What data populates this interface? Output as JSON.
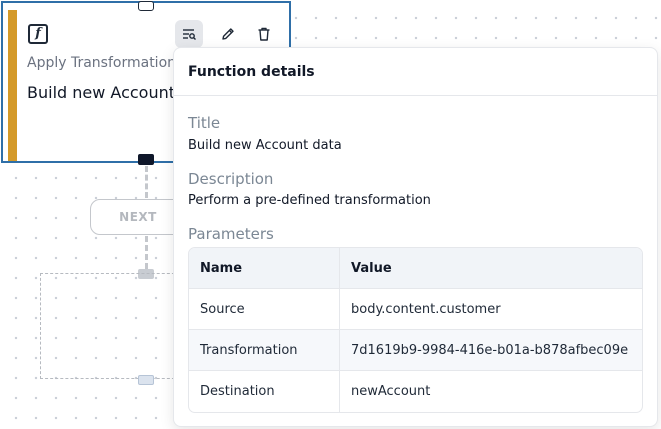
{
  "node": {
    "type_label": "Apply Transformation",
    "title": "Build new Account data",
    "icon": "function-icon",
    "accent_color": "#d49a2a"
  },
  "toolbar": {
    "details_icon": "details-list-icon",
    "edit_icon": "pencil-icon",
    "delete_icon": "trash-icon"
  },
  "canvas": {
    "next_label": "NEXT"
  },
  "popover": {
    "header": "Function details",
    "title_label": "Title",
    "title_value": "Build new Account data",
    "description_label": "Description",
    "description_value": "Perform a pre-defined transformation",
    "parameters_label": "Parameters",
    "table": {
      "columns": [
        "Name",
        "Value"
      ],
      "rows": [
        {
          "name": "Source",
          "value": "body.content.customer"
        },
        {
          "name": "Transformation",
          "value": "7d1619b9-9984-416e-b01a-b878afbec09e"
        },
        {
          "name": "Destination",
          "value": "newAccount"
        }
      ]
    }
  }
}
